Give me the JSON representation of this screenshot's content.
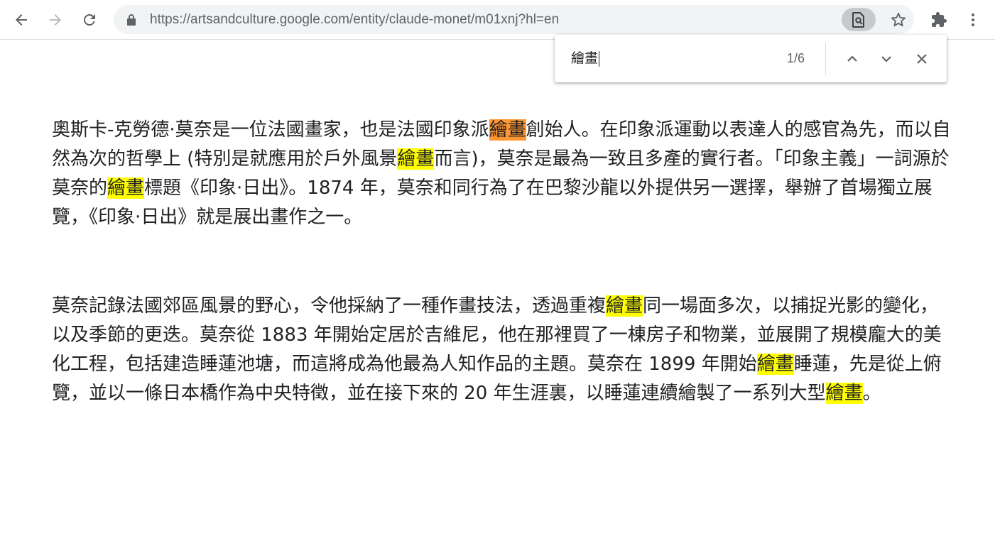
{
  "browser": {
    "url": "https://artsandculture.google.com/entity/claude-monet/m01xnj?hl=en",
    "icons": {
      "back": "back-arrow-icon",
      "forward": "forward-arrow-icon",
      "reload": "reload-icon",
      "lock": "lock-icon",
      "find_in_page": "find-in-page-icon",
      "bookmark": "star-icon",
      "extensions": "puzzle-icon",
      "menu": "kebab-menu-icon"
    }
  },
  "find_bar": {
    "query": "繪畫",
    "count": "1/6",
    "icons": {
      "previous": "chevron-up-icon",
      "next": "chevron-down-icon",
      "close": "close-icon"
    }
  },
  "highlight_colors": {
    "match": "#ffff00",
    "active_match": "#ff9632"
  },
  "article": {
    "paragraphs": [
      [
        {
          "text": "奧斯卡-克勞德·莫奈是一位法國畫家，也是法國印象派"
        },
        {
          "text": "繪畫",
          "match": "active"
        },
        {
          "text": "創始人。在印象派運動以表達人的感官為先，而以自然為次的哲學上 (特別是就應用於戶外風景"
        },
        {
          "text": "繪畫",
          "match": "yes"
        },
        {
          "text": "而言)，莫奈是最為一致且多產的實行者。「印象主義」一詞源於莫奈的"
        },
        {
          "text": "繪畫",
          "match": "yes"
        },
        {
          "text": "標題《印象·日出》。1874 年，莫奈和同行為了在巴黎沙龍以外提供另一選擇，舉辦了首場獨立展覽，《印象·日出》就是展出畫作之一。"
        }
      ],
      [
        {
          "text": "莫奈記錄法國郊區風景的野心，令他採納了一種作畫技法，透過重複"
        },
        {
          "text": "繪畫",
          "match": "yes"
        },
        {
          "text": "同一場面多次，以捕捉光影的變化，以及季節的更迭。莫奈從 1883 年開始定居於吉維尼，他在那裡買了一棟房子和物業，並展開了規模龐大的美化工程，包括建造睡蓮池塘，而這將成為他最為人知作品的主題。莫奈在 1899 年開始"
        },
        {
          "text": "繪畫",
          "match": "yes"
        },
        {
          "text": "睡蓮，先是從上俯覽，並以一條日本橋作為中央特徵，並在接下來的 20 年生涯裏，以睡蓮連續繪製了一系列大型"
        },
        {
          "text": "繪畫",
          "match": "yes"
        },
        {
          "text": "。"
        }
      ]
    ]
  }
}
